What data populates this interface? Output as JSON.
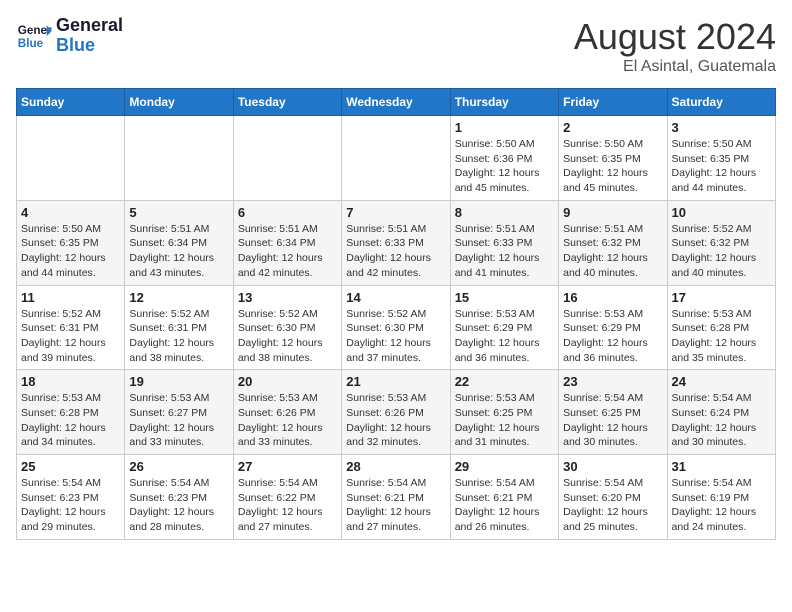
{
  "logo": {
    "general": "General",
    "blue": "Blue"
  },
  "title": {
    "month": "August 2024",
    "location": "El Asintal, Guatemala"
  },
  "weekdays": [
    "Sunday",
    "Monday",
    "Tuesday",
    "Wednesday",
    "Thursday",
    "Friday",
    "Saturday"
  ],
  "weeks": [
    [
      {
        "day": "",
        "info": ""
      },
      {
        "day": "",
        "info": ""
      },
      {
        "day": "",
        "info": ""
      },
      {
        "day": "",
        "info": ""
      },
      {
        "day": "1",
        "info": "Sunrise: 5:50 AM\nSunset: 6:36 PM\nDaylight: 12 hours\nand 45 minutes."
      },
      {
        "day": "2",
        "info": "Sunrise: 5:50 AM\nSunset: 6:35 PM\nDaylight: 12 hours\nand 45 minutes."
      },
      {
        "day": "3",
        "info": "Sunrise: 5:50 AM\nSunset: 6:35 PM\nDaylight: 12 hours\nand 44 minutes."
      }
    ],
    [
      {
        "day": "4",
        "info": "Sunrise: 5:50 AM\nSunset: 6:35 PM\nDaylight: 12 hours\nand 44 minutes."
      },
      {
        "day": "5",
        "info": "Sunrise: 5:51 AM\nSunset: 6:34 PM\nDaylight: 12 hours\nand 43 minutes."
      },
      {
        "day": "6",
        "info": "Sunrise: 5:51 AM\nSunset: 6:34 PM\nDaylight: 12 hours\nand 42 minutes."
      },
      {
        "day": "7",
        "info": "Sunrise: 5:51 AM\nSunset: 6:33 PM\nDaylight: 12 hours\nand 42 minutes."
      },
      {
        "day": "8",
        "info": "Sunrise: 5:51 AM\nSunset: 6:33 PM\nDaylight: 12 hours\nand 41 minutes."
      },
      {
        "day": "9",
        "info": "Sunrise: 5:51 AM\nSunset: 6:32 PM\nDaylight: 12 hours\nand 40 minutes."
      },
      {
        "day": "10",
        "info": "Sunrise: 5:52 AM\nSunset: 6:32 PM\nDaylight: 12 hours\nand 40 minutes."
      }
    ],
    [
      {
        "day": "11",
        "info": "Sunrise: 5:52 AM\nSunset: 6:31 PM\nDaylight: 12 hours\nand 39 minutes."
      },
      {
        "day": "12",
        "info": "Sunrise: 5:52 AM\nSunset: 6:31 PM\nDaylight: 12 hours\nand 38 minutes."
      },
      {
        "day": "13",
        "info": "Sunrise: 5:52 AM\nSunset: 6:30 PM\nDaylight: 12 hours\nand 38 minutes."
      },
      {
        "day": "14",
        "info": "Sunrise: 5:52 AM\nSunset: 6:30 PM\nDaylight: 12 hours\nand 37 minutes."
      },
      {
        "day": "15",
        "info": "Sunrise: 5:53 AM\nSunset: 6:29 PM\nDaylight: 12 hours\nand 36 minutes."
      },
      {
        "day": "16",
        "info": "Sunrise: 5:53 AM\nSunset: 6:29 PM\nDaylight: 12 hours\nand 36 minutes."
      },
      {
        "day": "17",
        "info": "Sunrise: 5:53 AM\nSunset: 6:28 PM\nDaylight: 12 hours\nand 35 minutes."
      }
    ],
    [
      {
        "day": "18",
        "info": "Sunrise: 5:53 AM\nSunset: 6:28 PM\nDaylight: 12 hours\nand 34 minutes."
      },
      {
        "day": "19",
        "info": "Sunrise: 5:53 AM\nSunset: 6:27 PM\nDaylight: 12 hours\nand 33 minutes."
      },
      {
        "day": "20",
        "info": "Sunrise: 5:53 AM\nSunset: 6:26 PM\nDaylight: 12 hours\nand 33 minutes."
      },
      {
        "day": "21",
        "info": "Sunrise: 5:53 AM\nSunset: 6:26 PM\nDaylight: 12 hours\nand 32 minutes."
      },
      {
        "day": "22",
        "info": "Sunrise: 5:53 AM\nSunset: 6:25 PM\nDaylight: 12 hours\nand 31 minutes."
      },
      {
        "day": "23",
        "info": "Sunrise: 5:54 AM\nSunset: 6:25 PM\nDaylight: 12 hours\nand 30 minutes."
      },
      {
        "day": "24",
        "info": "Sunrise: 5:54 AM\nSunset: 6:24 PM\nDaylight: 12 hours\nand 30 minutes."
      }
    ],
    [
      {
        "day": "25",
        "info": "Sunrise: 5:54 AM\nSunset: 6:23 PM\nDaylight: 12 hours\nand 29 minutes."
      },
      {
        "day": "26",
        "info": "Sunrise: 5:54 AM\nSunset: 6:23 PM\nDaylight: 12 hours\nand 28 minutes."
      },
      {
        "day": "27",
        "info": "Sunrise: 5:54 AM\nSunset: 6:22 PM\nDaylight: 12 hours\nand 27 minutes."
      },
      {
        "day": "28",
        "info": "Sunrise: 5:54 AM\nSunset: 6:21 PM\nDaylight: 12 hours\nand 27 minutes."
      },
      {
        "day": "29",
        "info": "Sunrise: 5:54 AM\nSunset: 6:21 PM\nDaylight: 12 hours\nand 26 minutes."
      },
      {
        "day": "30",
        "info": "Sunrise: 5:54 AM\nSunset: 6:20 PM\nDaylight: 12 hours\nand 25 minutes."
      },
      {
        "day": "31",
        "info": "Sunrise: 5:54 AM\nSunset: 6:19 PM\nDaylight: 12 hours\nand 24 minutes."
      }
    ]
  ]
}
